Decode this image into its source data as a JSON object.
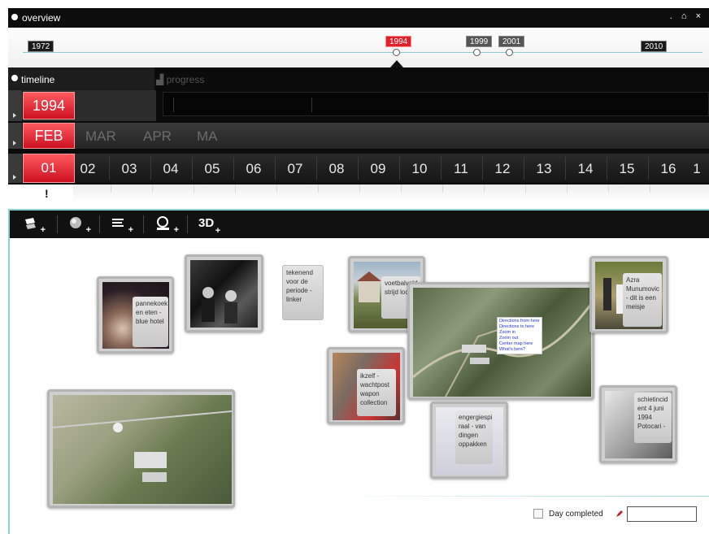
{
  "overview": {
    "title": "overview",
    "years": [
      {
        "label": "1972",
        "state": "normal"
      },
      {
        "label": "1994",
        "state": "selected"
      },
      {
        "label": "1999",
        "state": "event"
      },
      {
        "label": "2001",
        "state": "event"
      },
      {
        "label": "2010",
        "state": "normal"
      }
    ],
    "controls": ". ⌂ ×"
  },
  "timeline": {
    "title": "timeline",
    "year": "1994",
    "month": "FEB",
    "day": "01",
    "months": [
      "MAR",
      "APR",
      "MA"
    ],
    "days": [
      "02",
      "03",
      "04",
      "05",
      "06",
      "07",
      "08",
      "09",
      "10",
      "11",
      "12",
      "13",
      "14",
      "15",
      "16",
      "1"
    ],
    "marker": "!"
  },
  "progress": {
    "title": "progress"
  },
  "toolbar": {
    "three_d": "3D",
    "plus": "+"
  },
  "cards": {
    "c1": "pannekoek en eten - blue hotel",
    "c3": "tekenend voor de periode - linker",
    "c4": "voetbalveld strijd loc",
    "c5": "ikzelf - wachtpost wapon collection",
    "c6": "engergiespi raal - van dingen oppakken",
    "c7": "Azra Munumovic - dit is een meisje",
    "c8": "schietincid ent 4 juni 1994 Potocari -"
  },
  "map_menu": [
    "Directions from here",
    "Directions to here",
    "Zoom in",
    "Zoom out",
    "Center map here",
    "What's here?"
  ],
  "footer": {
    "day_completed": "Day completed",
    "input_value": ""
  },
  "colors": {
    "accent": "#e0202a",
    "teal": "#8fd0d4",
    "dark": "#0b0b0b"
  }
}
